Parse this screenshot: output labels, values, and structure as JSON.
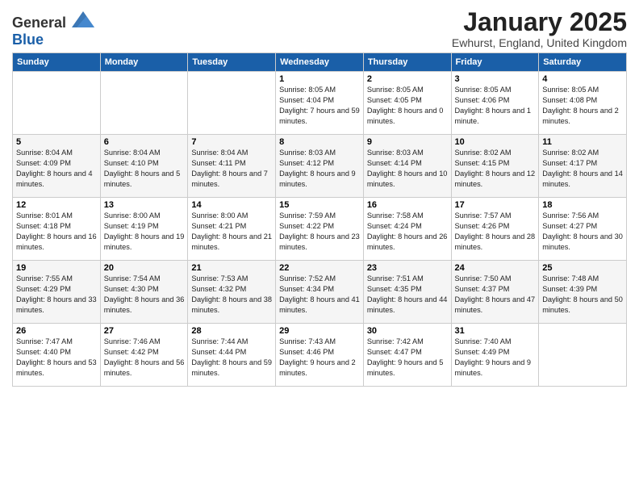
{
  "header": {
    "logo_general": "General",
    "logo_blue": "Blue",
    "title": "January 2025",
    "subtitle": "Ewhurst, England, United Kingdom"
  },
  "weekdays": [
    "Sunday",
    "Monday",
    "Tuesday",
    "Wednesday",
    "Thursday",
    "Friday",
    "Saturday"
  ],
  "weeks": [
    [
      {
        "day": "",
        "info": ""
      },
      {
        "day": "",
        "info": ""
      },
      {
        "day": "",
        "info": ""
      },
      {
        "day": "1",
        "info": "Sunrise: 8:05 AM\nSunset: 4:04 PM\nDaylight: 7 hours and 59 minutes."
      },
      {
        "day": "2",
        "info": "Sunrise: 8:05 AM\nSunset: 4:05 PM\nDaylight: 8 hours and 0 minutes."
      },
      {
        "day": "3",
        "info": "Sunrise: 8:05 AM\nSunset: 4:06 PM\nDaylight: 8 hours and 1 minute."
      },
      {
        "day": "4",
        "info": "Sunrise: 8:05 AM\nSunset: 4:08 PM\nDaylight: 8 hours and 2 minutes."
      }
    ],
    [
      {
        "day": "5",
        "info": "Sunrise: 8:04 AM\nSunset: 4:09 PM\nDaylight: 8 hours and 4 minutes."
      },
      {
        "day": "6",
        "info": "Sunrise: 8:04 AM\nSunset: 4:10 PM\nDaylight: 8 hours and 5 minutes."
      },
      {
        "day": "7",
        "info": "Sunrise: 8:04 AM\nSunset: 4:11 PM\nDaylight: 8 hours and 7 minutes."
      },
      {
        "day": "8",
        "info": "Sunrise: 8:03 AM\nSunset: 4:12 PM\nDaylight: 8 hours and 9 minutes."
      },
      {
        "day": "9",
        "info": "Sunrise: 8:03 AM\nSunset: 4:14 PM\nDaylight: 8 hours and 10 minutes."
      },
      {
        "day": "10",
        "info": "Sunrise: 8:02 AM\nSunset: 4:15 PM\nDaylight: 8 hours and 12 minutes."
      },
      {
        "day": "11",
        "info": "Sunrise: 8:02 AM\nSunset: 4:17 PM\nDaylight: 8 hours and 14 minutes."
      }
    ],
    [
      {
        "day": "12",
        "info": "Sunrise: 8:01 AM\nSunset: 4:18 PM\nDaylight: 8 hours and 16 minutes."
      },
      {
        "day": "13",
        "info": "Sunrise: 8:00 AM\nSunset: 4:19 PM\nDaylight: 8 hours and 19 minutes."
      },
      {
        "day": "14",
        "info": "Sunrise: 8:00 AM\nSunset: 4:21 PM\nDaylight: 8 hours and 21 minutes."
      },
      {
        "day": "15",
        "info": "Sunrise: 7:59 AM\nSunset: 4:22 PM\nDaylight: 8 hours and 23 minutes."
      },
      {
        "day": "16",
        "info": "Sunrise: 7:58 AM\nSunset: 4:24 PM\nDaylight: 8 hours and 26 minutes."
      },
      {
        "day": "17",
        "info": "Sunrise: 7:57 AM\nSunset: 4:26 PM\nDaylight: 8 hours and 28 minutes."
      },
      {
        "day": "18",
        "info": "Sunrise: 7:56 AM\nSunset: 4:27 PM\nDaylight: 8 hours and 30 minutes."
      }
    ],
    [
      {
        "day": "19",
        "info": "Sunrise: 7:55 AM\nSunset: 4:29 PM\nDaylight: 8 hours and 33 minutes."
      },
      {
        "day": "20",
        "info": "Sunrise: 7:54 AM\nSunset: 4:30 PM\nDaylight: 8 hours and 36 minutes."
      },
      {
        "day": "21",
        "info": "Sunrise: 7:53 AM\nSunset: 4:32 PM\nDaylight: 8 hours and 38 minutes."
      },
      {
        "day": "22",
        "info": "Sunrise: 7:52 AM\nSunset: 4:34 PM\nDaylight: 8 hours and 41 minutes."
      },
      {
        "day": "23",
        "info": "Sunrise: 7:51 AM\nSunset: 4:35 PM\nDaylight: 8 hours and 44 minutes."
      },
      {
        "day": "24",
        "info": "Sunrise: 7:50 AM\nSunset: 4:37 PM\nDaylight: 8 hours and 47 minutes."
      },
      {
        "day": "25",
        "info": "Sunrise: 7:48 AM\nSunset: 4:39 PM\nDaylight: 8 hours and 50 minutes."
      }
    ],
    [
      {
        "day": "26",
        "info": "Sunrise: 7:47 AM\nSunset: 4:40 PM\nDaylight: 8 hours and 53 minutes."
      },
      {
        "day": "27",
        "info": "Sunrise: 7:46 AM\nSunset: 4:42 PM\nDaylight: 8 hours and 56 minutes."
      },
      {
        "day": "28",
        "info": "Sunrise: 7:44 AM\nSunset: 4:44 PM\nDaylight: 8 hours and 59 minutes."
      },
      {
        "day": "29",
        "info": "Sunrise: 7:43 AM\nSunset: 4:46 PM\nDaylight: 9 hours and 2 minutes."
      },
      {
        "day": "30",
        "info": "Sunrise: 7:42 AM\nSunset: 4:47 PM\nDaylight: 9 hours and 5 minutes."
      },
      {
        "day": "31",
        "info": "Sunrise: 7:40 AM\nSunset: 4:49 PM\nDaylight: 9 hours and 9 minutes."
      },
      {
        "day": "",
        "info": ""
      }
    ]
  ]
}
